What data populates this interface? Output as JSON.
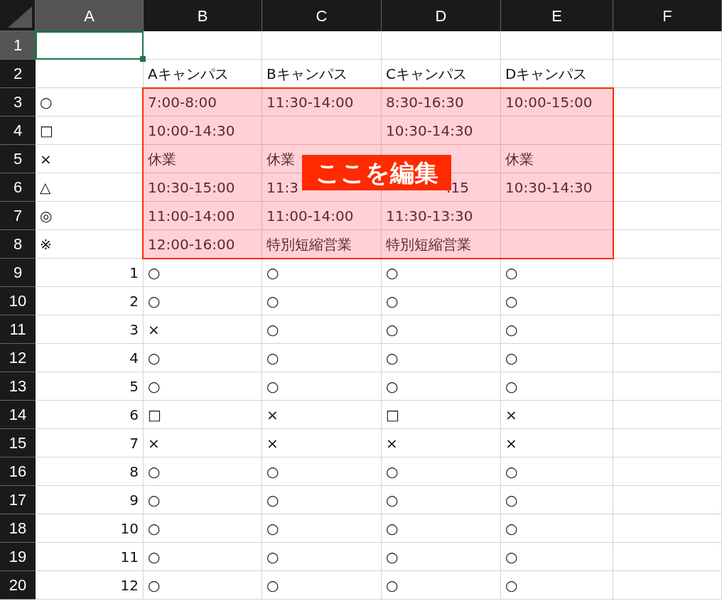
{
  "columns": [
    {
      "label": "A",
      "selected": true
    },
    {
      "label": "B",
      "selected": false
    },
    {
      "label": "C",
      "selected": false
    },
    {
      "label": "D",
      "selected": false
    },
    {
      "label": "E",
      "selected": false
    },
    {
      "label": "F",
      "selected": false
    }
  ],
  "rows": [
    {
      "label": "1",
      "selected": true,
      "cells": [
        {
          "highlighted": false
        },
        {
          "highlighted": false
        },
        {
          "highlighted": false
        },
        {
          "highlighted": false
        },
        {
          "highlighted": false
        },
        {
          "highlighted": false
        }
      ]
    },
    {
      "label": "2",
      "selected": false,
      "cells": [
        {
          "highlighted": false
        },
        {
          "text": "Aキャンパス",
          "highlighted": false
        },
        {
          "text": "Bキャンパス",
          "highlighted": false
        },
        {
          "text": "Cキャンパス",
          "highlighted": false
        },
        {
          "text": "Dキャンパス",
          "highlighted": false
        },
        {
          "highlighted": false
        }
      ]
    },
    {
      "label": "3",
      "selected": false,
      "cells": [
        {
          "text": "○",
          "highlighted": false
        },
        {
          "text": "7:00-8:00",
          "highlighted": true
        },
        {
          "text": "11:30-14:00",
          "highlighted": true
        },
        {
          "text": "8:30-16:30",
          "highlighted": true
        },
        {
          "text": "10:00-15:00",
          "highlighted": true
        },
        {
          "highlighted": false
        }
      ]
    },
    {
      "label": "4",
      "selected": false,
      "cells": [
        {
          "text": "□",
          "highlighted": false
        },
        {
          "text": "10:00-14:30",
          "highlighted": true
        },
        {
          "highlighted": true
        },
        {
          "text": "10:30-14:30",
          "highlighted": true
        },
        {
          "highlighted": true
        },
        {
          "highlighted": false
        }
      ]
    },
    {
      "label": "5",
      "selected": false,
      "cells": [
        {
          "text": "×",
          "highlighted": false
        },
        {
          "text": "休業",
          "highlighted": true
        },
        {
          "text": "休業",
          "highlighted": true
        },
        {
          "highlighted": true
        },
        {
          "text": "休業",
          "highlighted": true
        },
        {
          "highlighted": false
        }
      ]
    },
    {
      "label": "6",
      "selected": false,
      "cells": [
        {
          "text": "△",
          "highlighted": false
        },
        {
          "text": "10:30-15:00",
          "highlighted": true
        },
        {
          "text": "11:3",
          "highlighted": true
        },
        {
          "text": ":15",
          "kind": "covered_right",
          "highlighted": true
        },
        {
          "text": "10:30-14:30",
          "highlighted": true
        },
        {
          "highlighted": false
        }
      ]
    },
    {
      "label": "7",
      "selected": false,
      "cells": [
        {
          "text": "◎",
          "highlighted": false
        },
        {
          "text": "11:00-14:00",
          "highlighted": true
        },
        {
          "text": "11:00-14:00",
          "highlighted": true
        },
        {
          "text": "11:30-13:30",
          "highlighted": true
        },
        {
          "highlighted": true
        },
        {
          "highlighted": false
        }
      ]
    },
    {
      "label": "8",
      "selected": false,
      "cells": [
        {
          "text": "※",
          "highlighted": false
        },
        {
          "text": "12:00-16:00",
          "highlighted": true
        },
        {
          "text": "特別短縮営業",
          "highlighted": true
        },
        {
          "text": "特別短縮営業",
          "highlighted": true
        },
        {
          "highlighted": true
        },
        {
          "highlighted": false
        }
      ]
    },
    {
      "label": "9",
      "selected": false,
      "cells": [
        {
          "text": "1",
          "kind": "number",
          "highlighted": false
        },
        {
          "text": "○",
          "highlighted": false
        },
        {
          "text": "○",
          "highlighted": false
        },
        {
          "text": "○",
          "highlighted": false
        },
        {
          "text": "○",
          "highlighted": false
        },
        {
          "highlighted": false
        }
      ]
    },
    {
      "label": "10",
      "selected": false,
      "cells": [
        {
          "text": "2",
          "kind": "number",
          "highlighted": false
        },
        {
          "text": "○",
          "highlighted": false
        },
        {
          "text": "○",
          "highlighted": false
        },
        {
          "text": "○",
          "highlighted": false
        },
        {
          "text": "○",
          "highlighted": false
        },
        {
          "highlighted": false
        }
      ]
    },
    {
      "label": "11",
      "selected": false,
      "cells": [
        {
          "text": "3",
          "kind": "number",
          "highlighted": false
        },
        {
          "text": "×",
          "highlighted": false
        },
        {
          "text": "○",
          "highlighted": false
        },
        {
          "text": "○",
          "highlighted": false
        },
        {
          "text": "○",
          "highlighted": false
        },
        {
          "highlighted": false
        }
      ]
    },
    {
      "label": "12",
      "selected": false,
      "cells": [
        {
          "text": "4",
          "kind": "number",
          "highlighted": false
        },
        {
          "text": "○",
          "highlighted": false
        },
        {
          "text": "○",
          "highlighted": false
        },
        {
          "text": "○",
          "highlighted": false
        },
        {
          "text": "○",
          "highlighted": false
        },
        {
          "highlighted": false
        }
      ]
    },
    {
      "label": "13",
      "selected": false,
      "cells": [
        {
          "text": "5",
          "kind": "number",
          "highlighted": false
        },
        {
          "text": "○",
          "highlighted": false
        },
        {
          "text": "○",
          "highlighted": false
        },
        {
          "text": "○",
          "highlighted": false
        },
        {
          "text": "○",
          "highlighted": false
        },
        {
          "highlighted": false
        }
      ]
    },
    {
      "label": "14",
      "selected": false,
      "cells": [
        {
          "text": "6",
          "kind": "number",
          "highlighted": false
        },
        {
          "text": "□",
          "highlighted": false
        },
        {
          "text": "×",
          "highlighted": false
        },
        {
          "text": "□",
          "highlighted": false
        },
        {
          "text": "×",
          "highlighted": false
        },
        {
          "highlighted": false
        }
      ]
    },
    {
      "label": "15",
      "selected": false,
      "cells": [
        {
          "text": "7",
          "kind": "number",
          "highlighted": false
        },
        {
          "text": "×",
          "highlighted": false
        },
        {
          "text": "×",
          "highlighted": false
        },
        {
          "text": "×",
          "highlighted": false
        },
        {
          "text": "×",
          "highlighted": false
        },
        {
          "highlighted": false
        }
      ]
    },
    {
      "label": "16",
      "selected": false,
      "cells": [
        {
          "text": "8",
          "kind": "number",
          "highlighted": false
        },
        {
          "text": "○",
          "highlighted": false
        },
        {
          "text": "○",
          "highlighted": false
        },
        {
          "text": "○",
          "highlighted": false
        },
        {
          "text": "○",
          "highlighted": false
        },
        {
          "highlighted": false
        }
      ]
    },
    {
      "label": "17",
      "selected": false,
      "cells": [
        {
          "text": "9",
          "kind": "number",
          "highlighted": false
        },
        {
          "text": "○",
          "highlighted": false
        },
        {
          "text": "○",
          "highlighted": false
        },
        {
          "text": "○",
          "highlighted": false
        },
        {
          "text": "○",
          "highlighted": false
        },
        {
          "highlighted": false
        }
      ]
    },
    {
      "label": "18",
      "selected": false,
      "cells": [
        {
          "text": "10",
          "kind": "number",
          "highlighted": false
        },
        {
          "text": "○",
          "highlighted": false
        },
        {
          "text": "○",
          "highlighted": false
        },
        {
          "text": "○",
          "highlighted": false
        },
        {
          "text": "○",
          "highlighted": false
        },
        {
          "highlighted": false
        }
      ]
    },
    {
      "label": "19",
      "selected": false,
      "cells": [
        {
          "text": "11",
          "kind": "number",
          "highlighted": false
        },
        {
          "text": "○",
          "highlighted": false
        },
        {
          "text": "○",
          "highlighted": false
        },
        {
          "text": "○",
          "highlighted": false
        },
        {
          "text": "○",
          "highlighted": false
        },
        {
          "highlighted": false
        }
      ]
    },
    {
      "label": "20",
      "selected": false,
      "cells": [
        {
          "text": "12",
          "kind": "number",
          "highlighted": false
        },
        {
          "text": "○",
          "highlighted": false
        },
        {
          "text": "○",
          "highlighted": false
        },
        {
          "text": "○",
          "highlighted": false
        },
        {
          "text": "○",
          "highlighted": false
        },
        {
          "highlighted": false
        }
      ]
    }
  ],
  "callout": {
    "text": "ここを編集"
  }
}
